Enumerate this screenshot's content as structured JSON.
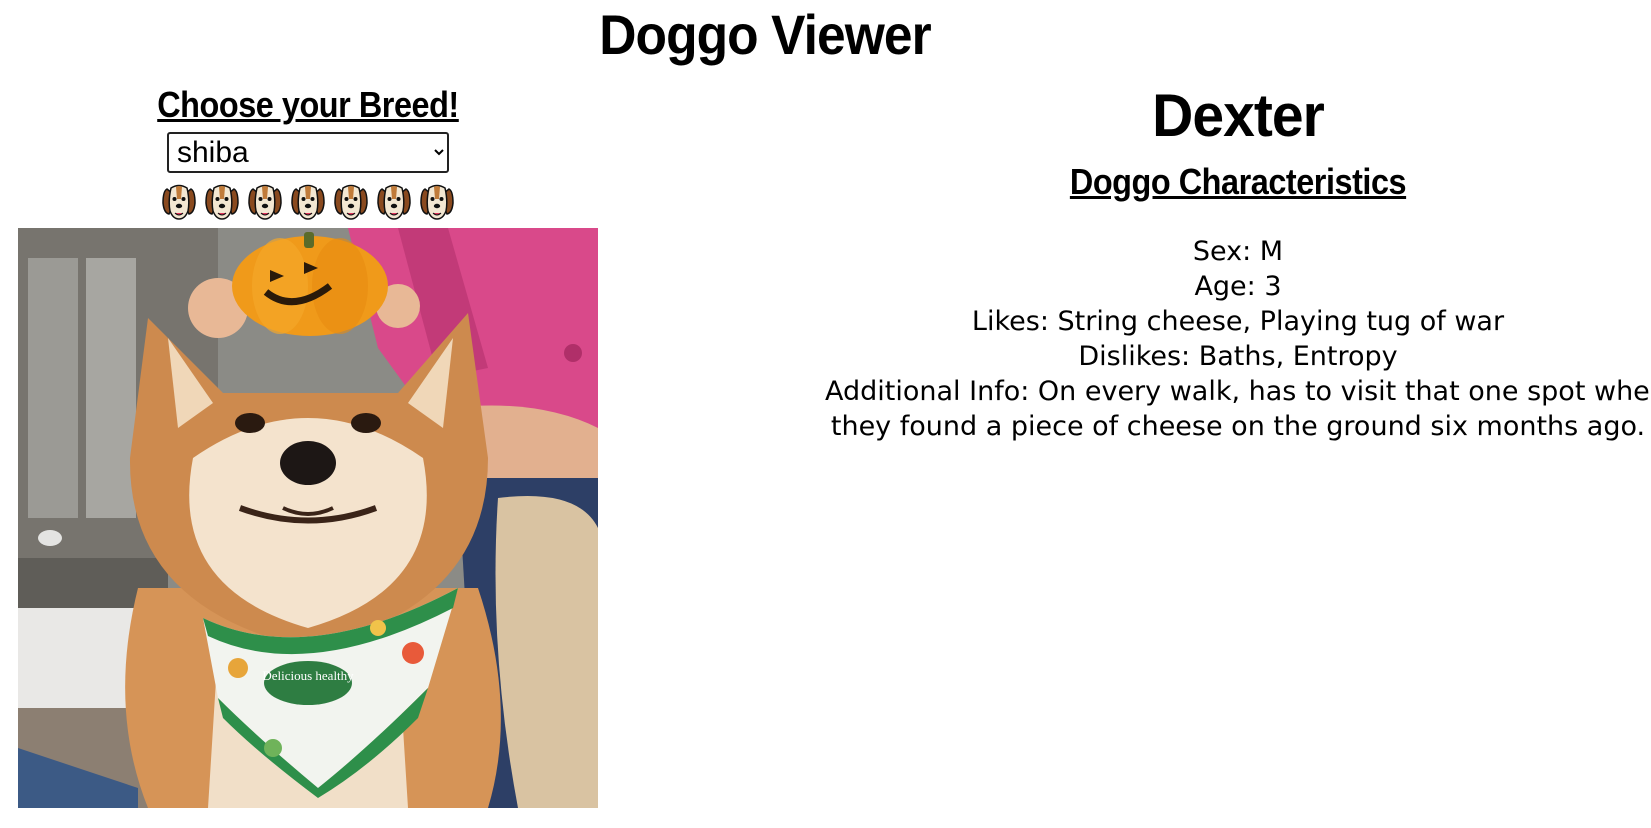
{
  "app": {
    "title": "Doggo Viewer"
  },
  "breed_picker": {
    "heading": "Choose your Breed!",
    "selected": "shiba",
    "rating_icon": "dog-face-icon",
    "rating_count": 7
  },
  "dog": {
    "name": "Dexter",
    "characteristics_heading": "Doggo Characteristics",
    "sex": "Sex: M",
    "age": "Age: 3",
    "likes": "Likes: String cheese, Playing tug of war",
    "dislikes": "Dislikes: Baths, Entropy",
    "additional_info_line1": "Additional Info: On every walk, has to visit that one spot where",
    "additional_info_line2": "they found a piece of cheese on the ground six months ago."
  },
  "photo": {
    "bandana_text": "Delicious healthy"
  }
}
